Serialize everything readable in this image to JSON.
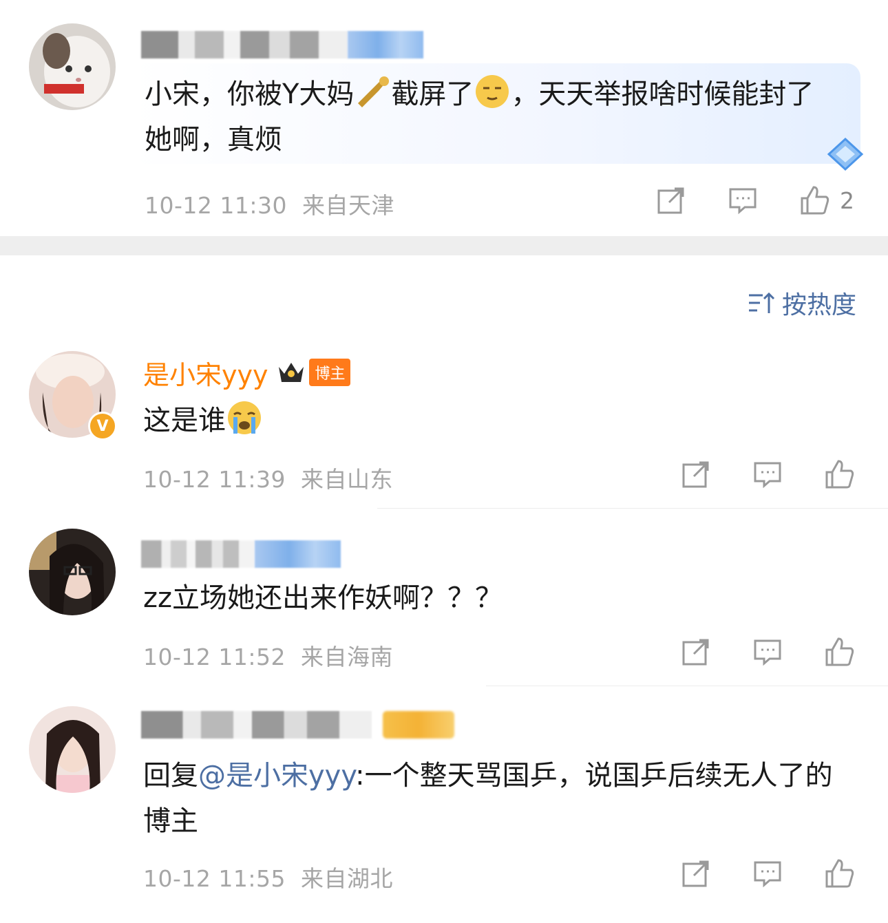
{
  "comments_top": {
    "content_pre": "小宋，你被Y大妈",
    "content_mid": "截屏了",
    "content_post": "，天天举报啥时候能封了她啊，真烦",
    "time": "10-12 11:30",
    "location": "来自天津",
    "likes": "2"
  },
  "sort": {
    "label": "按热度"
  },
  "comments": [
    {
      "username": "是小宋yyy",
      "tag": "博主",
      "content": "这是谁",
      "time": "10-12 11:39",
      "location": "来自山东"
    },
    {
      "content": "zz立场她还出来作妖啊？？？",
      "time": "10-12 11:52",
      "location": "来自海南"
    },
    {
      "reply_prefix": "回复",
      "mention": "@是小宋yyy",
      "content": ":一个整天骂国乒，说国乒后续无人了的博主",
      "time": "10-12 11:55",
      "location": "来自湖北"
    }
  ],
  "colors": {
    "accent_blue": "#4d6fa3",
    "username_orange": "#ff8200",
    "meta_gray": "#a6a6a6"
  },
  "icons": [
    "share-icon",
    "comment-icon",
    "like-icon",
    "sort-icon",
    "verified-icon",
    "crown-icon"
  ]
}
